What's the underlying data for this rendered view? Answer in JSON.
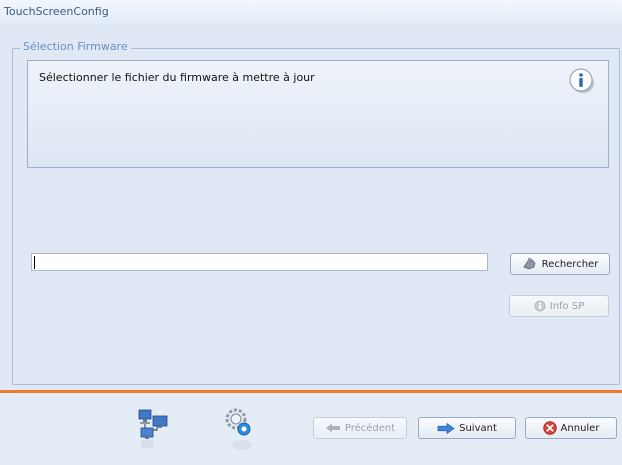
{
  "window": {
    "title": "TouchScreenConfig"
  },
  "group": {
    "legend": "Sélection Firmware",
    "info_text": "Sélectionner le fichier du firmware à mettre à jour",
    "info_icon": "info-icon"
  },
  "file": {
    "value": "",
    "placeholder": ""
  },
  "buttons": {
    "rechercher": "Rechercher",
    "info_sp": "Info SP",
    "precedent": "Précédent",
    "suivant": "Suivant",
    "annuler": "Annuler"
  },
  "colors": {
    "accent_separator": "#ef7c2b",
    "panel_background": "#dfe8f4",
    "legend_text": "#6d8fbf"
  },
  "footer_steps": [
    "network-computers-icon",
    "settings-gear-icon"
  ]
}
